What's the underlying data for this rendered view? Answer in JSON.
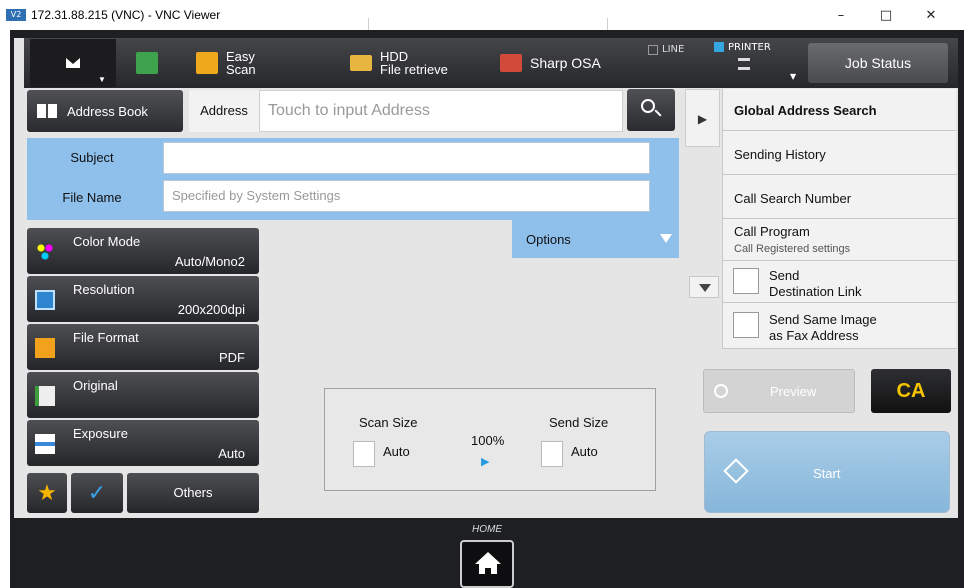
{
  "window": {
    "logo": "V2",
    "title": "172.31.88.215 (VNC) - VNC Viewer",
    "minimize": "–",
    "maximize": "□",
    "close": "✕"
  },
  "topbar": {
    "mode_icon": "envelope-icon",
    "easy_scan": [
      "Easy",
      "Scan"
    ],
    "hdd": [
      "HDD",
      "File retrieve"
    ],
    "sharp_osa": "Sharp OSA",
    "line_label": "LINE",
    "printer_label": "PRINTER",
    "job_status": "Job Status",
    "printer_color": "#35a6e0"
  },
  "address": {
    "book_label": "Address Book",
    "label": "Address",
    "placeholder": "Touch to input Address"
  },
  "fields": {
    "subject_label": "Subject",
    "subject_value": "",
    "filename_label": "File Name",
    "filename_placeholder": "Specified by System Settings",
    "options_label": "Options"
  },
  "functions": [
    {
      "name": "Color Mode",
      "value": "Auto/Mono2"
    },
    {
      "name": "Resolution",
      "value": "200x200dpi"
    },
    {
      "name": "File Format",
      "value": "PDF"
    },
    {
      "name": "Original",
      "value": ""
    },
    {
      "name": "Exposure",
      "value": "Auto"
    }
  ],
  "bottom": {
    "others_label": "Others"
  },
  "size_panel": {
    "scan_size_label": "Scan Size",
    "scan_size_value": "Auto",
    "ratio": "100%",
    "send_size_label": "Send Size",
    "send_size_value": "Auto"
  },
  "right_menu": {
    "global_search": "Global Address Search",
    "sending_history": "Sending History",
    "call_search_number": "Call Search Number",
    "call_program": "Call Program",
    "call_program_sub": "Call Registered settings",
    "send_dest_link": [
      "Send",
      "Destination Link"
    ],
    "send_same_image": [
      "Send Same Image",
      "as Fax Address"
    ]
  },
  "actions": {
    "preview": "Preview",
    "ca": "CA",
    "start": "Start"
  },
  "home": {
    "label": "HOME"
  },
  "colors": {
    "accent_blue": "#8fc0ec",
    "ca_yellow": "#f5c400",
    "start_blue": "#86b6d9"
  }
}
